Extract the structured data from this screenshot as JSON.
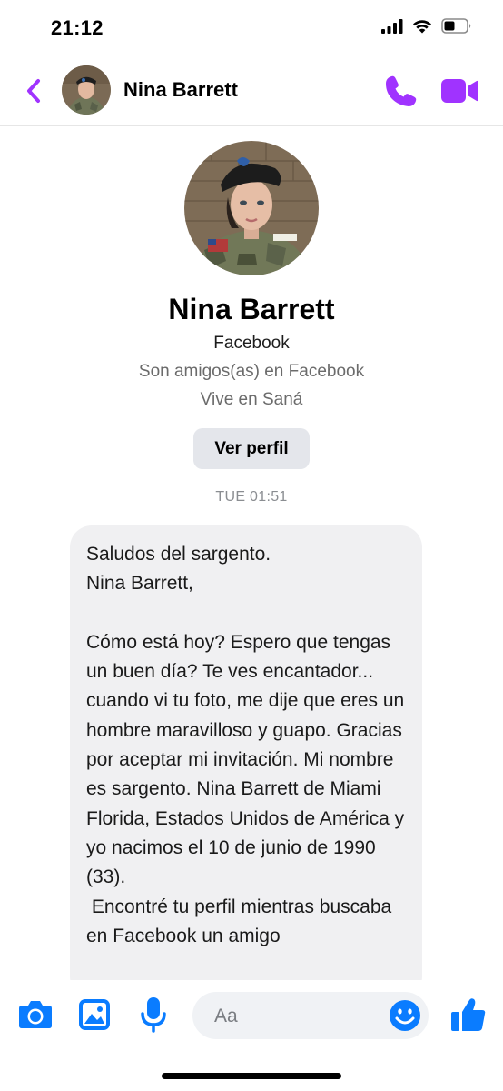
{
  "status_bar": {
    "time": "21:12",
    "icons": [
      "signal-icon",
      "wifi-icon",
      "battery-icon"
    ]
  },
  "header": {
    "back_icon": "chevron-left-icon",
    "contact_name": "Nina Barrett",
    "call_icon": "phone-icon",
    "video_icon": "video-camera-icon",
    "accent_color": "#a033ff"
  },
  "profile": {
    "name": "Nina Barrett",
    "platform": "Facebook",
    "friends_status": "Son amigos(as) en Facebook",
    "location": "Vive en Saná",
    "view_profile_label": "Ver perfil"
  },
  "conversation": {
    "timestamp": "TUE 01:51",
    "messages": [
      {
        "from": "Nina Barrett",
        "text": "Saludos del sargento.\nNina Barrett,\n\nCómo está hoy? Espero que tengas un buen día? Te ves encantador... cuando vi tu foto, me dije que eres un hombre maravilloso y guapo. Gracias por aceptar mi invitación. Mi nombre es sargento. Nina Barrett de Miami Florida, Estados Unidos de América y yo nacimos el 10 de junio de 1990 (33).\n Encontré tu perfil mientras buscaba en Facebook un amigo"
      }
    ]
  },
  "composer": {
    "placeholder": "Aa",
    "value": "",
    "icons": [
      "camera-icon",
      "image-icon",
      "microphone-icon",
      "emoji-icon",
      "thumbs-up-icon"
    ]
  }
}
